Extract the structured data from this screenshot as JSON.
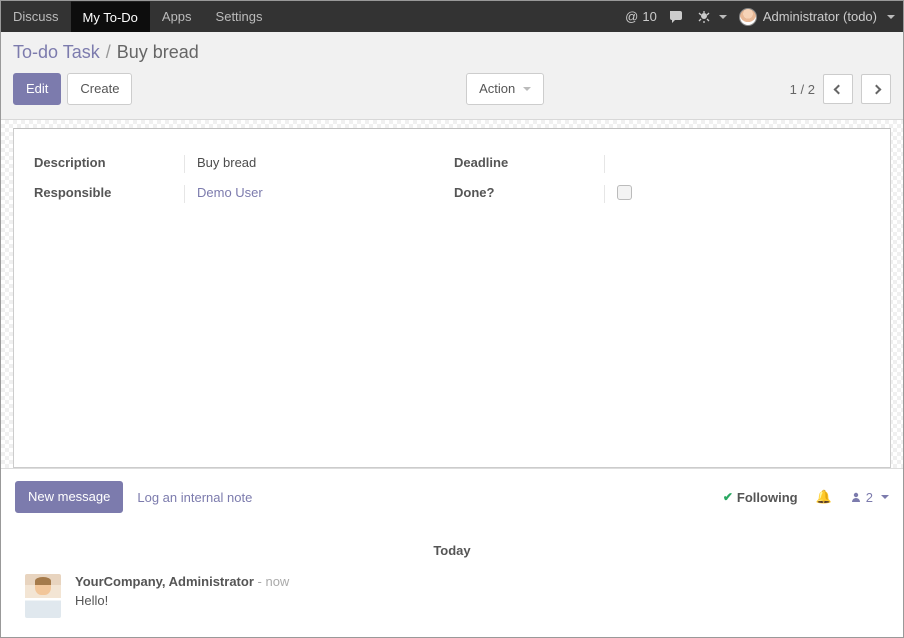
{
  "topnav": {
    "items": [
      "Discuss",
      "My To-Do",
      "Apps",
      "Settings"
    ],
    "active_index": 1,
    "mention_count": "10",
    "user_label": "Administrator (todo)"
  },
  "header": {
    "breadcrumb_root": "To-do Task",
    "breadcrumb_sep": "/",
    "breadcrumb_current": "Buy bread",
    "edit_label": "Edit",
    "create_label": "Create",
    "action_label": "Action",
    "pager": {
      "current": "1",
      "sep": "/",
      "total": "2"
    }
  },
  "form": {
    "labels": {
      "description": "Description",
      "responsible": "Responsible",
      "deadline": "Deadline",
      "done": "Done?"
    },
    "values": {
      "description": "Buy bread",
      "responsible": "Demo User",
      "deadline": "",
      "done_checked": false
    }
  },
  "chatter": {
    "new_message": "New message",
    "log_note": "Log an internal note",
    "following_label": "Following",
    "followers_count": "2",
    "day_label": "Today",
    "messages": [
      {
        "author": "YourCompany, Administrator",
        "time": "now",
        "body": "Hello!"
      }
    ]
  }
}
